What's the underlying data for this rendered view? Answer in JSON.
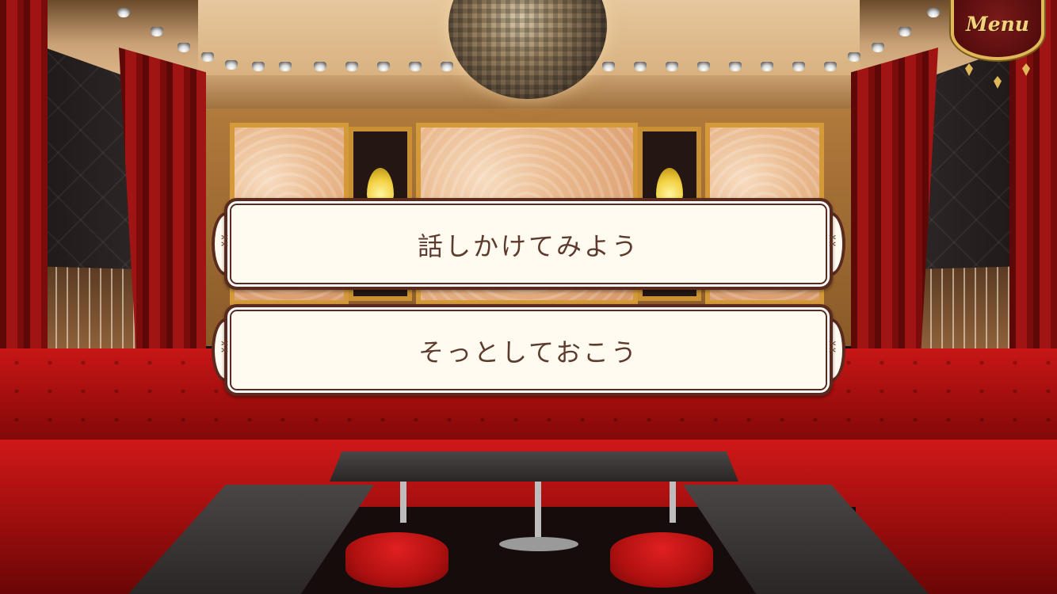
{
  "menu": {
    "label": "Menu",
    "icon": "ornate-menu-plate"
  },
  "choices": [
    {
      "label": "話しかけてみよう"
    },
    {
      "label": "そっとしておこう"
    }
  ],
  "colors": {
    "choice_background": "#fffbf0",
    "choice_border": "#5a2a1e",
    "choice_text": "#5e3a2e",
    "menu_gold": "#e0b85a",
    "menu_red": "#4a0808"
  }
}
